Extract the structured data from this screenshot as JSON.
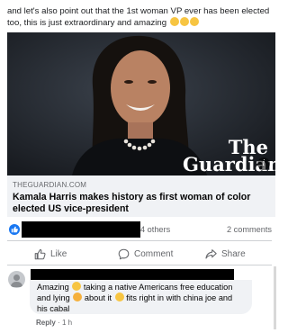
{
  "post": {
    "text": "and let's also point out that the 1st woman VP ever has been elected too, this is just extraordinary and amazing",
    "emoji_icon": "clapping-hands"
  },
  "link": {
    "logo_line1": "The",
    "logo_line2": "Guardian",
    "info_glyph": "i",
    "domain": "THEGUARDIAN.COM",
    "headline": "Kamala Harris makes history as first woman of color elected US vice-president"
  },
  "reactions": {
    "others": "4 others",
    "comments": "2 comments",
    "icon": "like-icon"
  },
  "actions": {
    "like": "Like",
    "comment": "Comment",
    "share": "Share"
  },
  "comment": {
    "part1": "Amazing",
    "part2": "taking a native Americans free education and lying",
    "part3": "about it",
    "part4": "fits right in with china joe and his cabal",
    "reply": "Reply",
    "separator": "·",
    "time": "1 h"
  },
  "colors": {
    "facebook_blue": "#1877f2",
    "meta_bg": "#f0f2f5",
    "muted_text": "#65676b"
  }
}
